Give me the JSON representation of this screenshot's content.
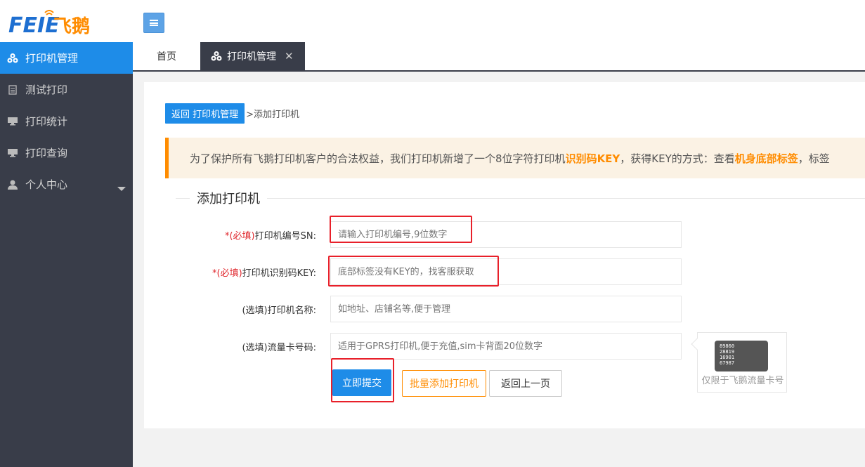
{
  "header": {
    "logo_text": "FEIE",
    "logo_cn": "飞鹅"
  },
  "sidebar": {
    "items": [
      {
        "label": "打印机管理",
        "icon": "printer-group-icon"
      },
      {
        "label": "测试打印",
        "icon": "document-icon"
      },
      {
        "label": "打印统计",
        "icon": "monitor-icon"
      },
      {
        "label": "打印查询",
        "icon": "monitor-icon"
      },
      {
        "label": "个人中心",
        "icon": "user-icon"
      }
    ]
  },
  "tabs": {
    "home": "首页",
    "active": "打印机管理",
    "close": "✕"
  },
  "breadcrumb": {
    "back": "返回 打印机管理",
    "current": ">添加打印机"
  },
  "notice": {
    "p1": "为了保护所有飞鹅打印机客户的合法权益，我们打印机新增了一个8位字符打印机",
    "h1": "识别码KEY",
    "p2": "，获得KEY的方式：查看",
    "h2": "机身底部标签",
    "p3": "，标签"
  },
  "form": {
    "legend": "添加打印机",
    "required_tag": "*(必填)",
    "sn_label": "打印机编号SN:",
    "sn_placeholder": "请输入打印机编号,9位数字",
    "key_label": "打印机识别码KEY:",
    "key_placeholder": "底部标签没有KEY的，找客服获取",
    "name_label": "(选填)打印机名称:",
    "name_placeholder": "如地址、店铺名等,便于管理",
    "sim_label": "(选填)流量卡号码:",
    "sim_placeholder": "适用于GPRS打印机,便于充值,sim卡背面20位数字"
  },
  "sim_card": {
    "numbers": [
      "89860",
      "28819",
      "16901",
      "67987"
    ],
    "caption": "仅限于飞鹅流量卡号"
  },
  "buttons": {
    "submit": "立即提交",
    "batch_add": "批量添加打印机",
    "back": "返回上一页"
  },
  "colors": {
    "primary": "#1e8ce8",
    "sidebar_bg": "#393d49",
    "accent_orange": "#ff8c00",
    "required_red": "#e0282e",
    "highlight_box": "#e8202a"
  }
}
